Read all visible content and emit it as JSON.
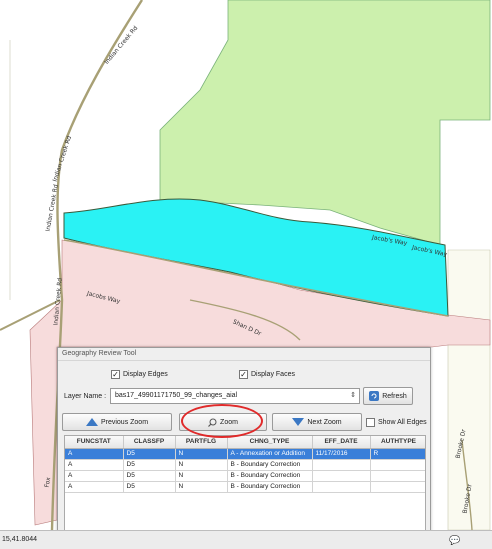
{
  "map": {
    "labels": {
      "road1": "Indian Creek Rd",
      "road2": "Indian Creek Rd",
      "road3": "Indian Creek Rd",
      "road4": "Indian Creek Rd",
      "road5": "Jacobs Way",
      "road6": "Jacob's Way",
      "road7": "Jacob's Way",
      "road8": "Shan D Dr",
      "road9": "Brooke Dr",
      "road10": "Brooke Dr",
      "road11": "Fox"
    },
    "colors": {
      "green_face": "#ccf0ad",
      "cyan_face": "#2af2f4",
      "pink_face": "#f7dcdc",
      "beige_face": "#fafaf0",
      "road_line": "#a8a075"
    }
  },
  "panel": {
    "title": "Geography Review Tool",
    "display_edges": "Display Edges",
    "display_faces": "Display Faces",
    "layer_label": "Layer Name :",
    "layer_value": "bas17_49901171750_99_changes_aial",
    "refresh": "Refresh",
    "previous_zoom": "Previous Zoom",
    "zoom": "Zoom",
    "next_zoom": "Next Zoom",
    "show_all_edges": "Show All Edges",
    "columns": [
      "FUNCSTAT",
      "CLASSFP",
      "PARTFLG",
      "CHNG_TYPE",
      "EFF_DATE",
      "AUTHTYPE"
    ],
    "rows": [
      [
        "A",
        "D5",
        "N",
        "A - Annexation or Addition",
        "11/17/2016",
        "R"
      ],
      [
        "A",
        "D5",
        "N",
        "B - Boundary Correction",
        "",
        ""
      ],
      [
        "A",
        "D5",
        "N",
        "B - Boundary Correction",
        "",
        ""
      ],
      [
        "A",
        "D5",
        "N",
        "B - Boundary Correction",
        "",
        ""
      ]
    ]
  },
  "statusbar": {
    "coordinate": "15,41.8044"
  }
}
